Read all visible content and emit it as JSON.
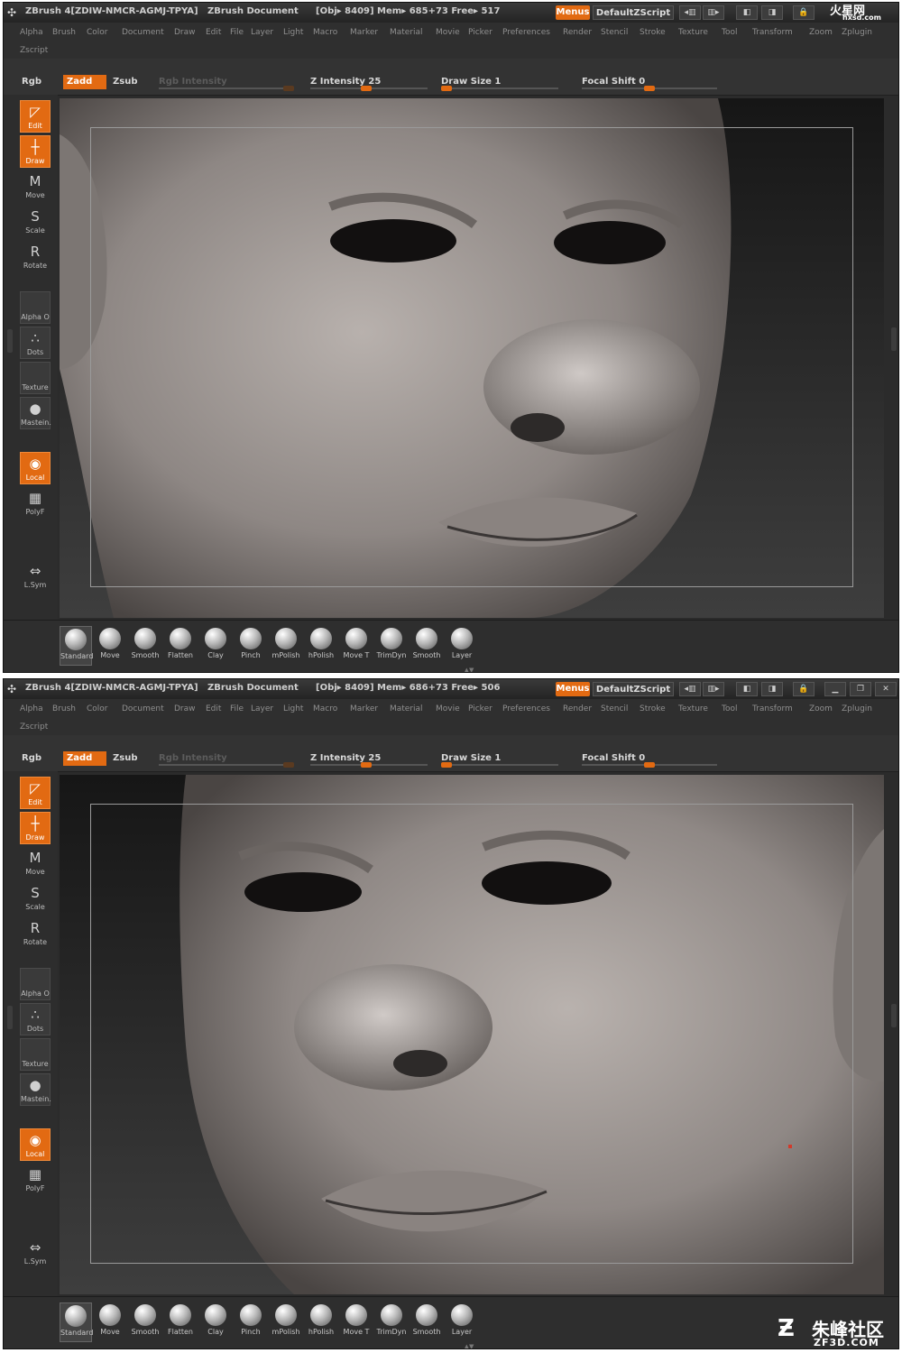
{
  "screens": [
    {
      "id": "top",
      "title": {
        "app": "ZBrush 4[ZDIW-NMCR-AGMJ-TPYA]",
        "document": "ZBrush Document",
        "stats": "[Obj▸ 8409] Mem▸ 685+73 Free▸ 517"
      }
    },
    {
      "id": "bottom",
      "title": {
        "app": "ZBrush 4[ZDIW-NMCR-AGMJ-TPYA]",
        "document": "ZBrush Document",
        "stats": "[Obj▸ 8409] Mem▸ 686+73 Free▸ 506"
      }
    }
  ],
  "window_buttons": {
    "menus": "Menus",
    "script": "DefaultZScript"
  },
  "menu_items": [
    "Alpha",
    "Brush",
    "Color",
    "Document",
    "Draw",
    "Edit",
    "File",
    "Layer",
    "Light",
    "Macro",
    "Marker",
    "Material",
    "Movie",
    "Picker",
    "Preferences",
    "Render",
    "Stencil",
    "Stroke",
    "Texture",
    "Tool",
    "Transform",
    "Zoom",
    "Zplugin"
  ],
  "menu_second_row": "Zscript",
  "top_shelf": {
    "rgb": "Rgb",
    "zadd": "Zadd",
    "zsub": "Zsub",
    "rgb_intensity": "Rgb  Intensity",
    "z_intensity": "Z  Intensity 25",
    "draw_size": "Draw  Size 1",
    "focal_shift": "Focal  Shift 0"
  },
  "left_tools": [
    {
      "label": "Edit",
      "icon": "edit-icon",
      "glyph": "◸",
      "active": true
    },
    {
      "label": "Draw",
      "icon": "draw-icon",
      "glyph": "┼",
      "active": true
    },
    {
      "label": "Move",
      "icon": "move-icon",
      "glyph": "M",
      "active": false
    },
    {
      "label": "Scale",
      "icon": "scale-icon",
      "glyph": "S",
      "active": false
    },
    {
      "label": "Rotate",
      "icon": "rotate-icon",
      "glyph": "R",
      "active": false
    }
  ],
  "left_slots": [
    {
      "label": "Alpha  O",
      "icon": "alpha-icon",
      "glyph": ""
    },
    {
      "label": "Dots",
      "icon": "dots-stroke-icon",
      "glyph": "∴"
    },
    {
      "label": "Texture",
      "icon": "texture-icon",
      "glyph": ""
    },
    {
      "label": "Mastein.",
      "icon": "material-sphere-icon",
      "glyph": "●"
    }
  ],
  "left_bottom": [
    {
      "label": "Local",
      "icon": "local-icon",
      "glyph": "◉",
      "active": true
    },
    {
      "label": "PolyF",
      "icon": "polyframe-icon",
      "glyph": "▦",
      "active": false
    },
    {
      "label": "L.Sym",
      "icon": "local-symmetry-icon",
      "glyph": "⇔",
      "active": false
    }
  ],
  "brushes": [
    "Standard",
    "Move",
    "Smooth",
    "Flatten",
    "Clay",
    "Pinch",
    "mPolish",
    "hPolish",
    "Move T",
    "TrimDyn",
    "Smooth",
    "Layer"
  ],
  "watermarks": {
    "top": "火星网",
    "top_sub": "hxsd.com",
    "bottom": "朱峰社区",
    "bottom_sub": "ZF3D.COM"
  }
}
